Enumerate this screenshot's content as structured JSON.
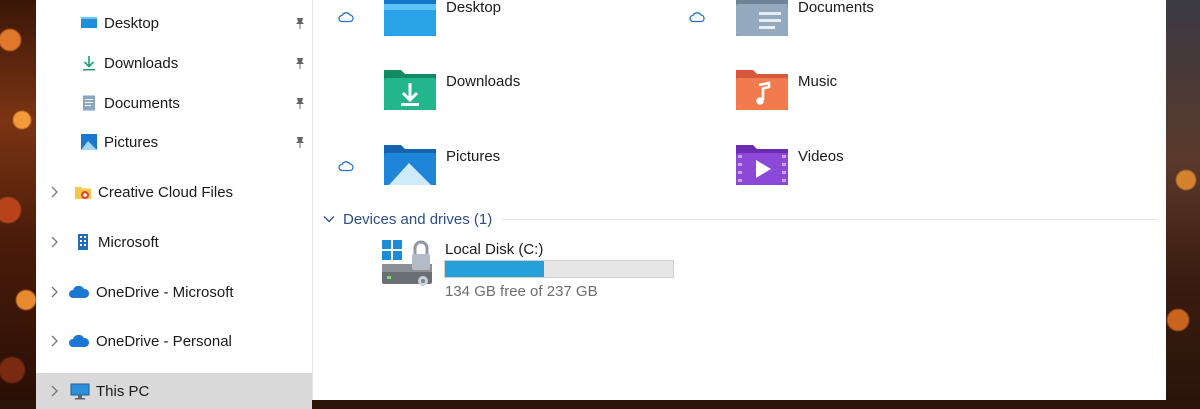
{
  "nav": {
    "quick_access": [
      {
        "label": "Desktop",
        "icon": "desktop-icon",
        "pinned": true
      },
      {
        "label": "Downloads",
        "icon": "downloads-icon",
        "pinned": true
      },
      {
        "label": "Documents",
        "icon": "documents-icon",
        "pinned": true
      },
      {
        "label": "Pictures",
        "icon": "pictures-icon",
        "pinned": true
      }
    ],
    "roots": [
      {
        "label": "Creative Cloud Files",
        "icon": "creative-cloud-folder-icon"
      },
      {
        "label": "Microsoft",
        "icon": "building-icon"
      },
      {
        "label": "OneDrive - Microsoft",
        "icon": "onedrive-cloud-icon"
      },
      {
        "label": "OneDrive - Personal",
        "icon": "onedrive-cloud-icon"
      },
      {
        "label": "This PC",
        "icon": "this-pc-icon",
        "selected": true
      }
    ]
  },
  "folders": [
    {
      "label": "Desktop",
      "icon": "desktop-folder-icon",
      "cloud_status": true
    },
    {
      "label": "Documents",
      "icon": "documents-folder-icon",
      "cloud_status": true
    },
    {
      "label": "Downloads",
      "icon": "downloads-folder-icon",
      "cloud_status": false
    },
    {
      "label": "Music",
      "icon": "music-folder-icon",
      "cloud_status": false
    },
    {
      "label": "Pictures",
      "icon": "pictures-folder-icon",
      "cloud_status": true
    },
    {
      "label": "Videos",
      "icon": "videos-folder-icon",
      "cloud_status": false
    }
  ],
  "devices_group": {
    "title": "Devices and drives (1)",
    "drives": [
      {
        "label": "Local Disk (C:)",
        "free_text": "134 GB free of 237 GB",
        "used_fraction": 0.435,
        "icon": "bitlocker-drive-icon"
      }
    ]
  },
  "colors": {
    "accent": "#26a0da",
    "group_header": "#2b4d8c",
    "selected_bg": "#d9d9d9"
  }
}
